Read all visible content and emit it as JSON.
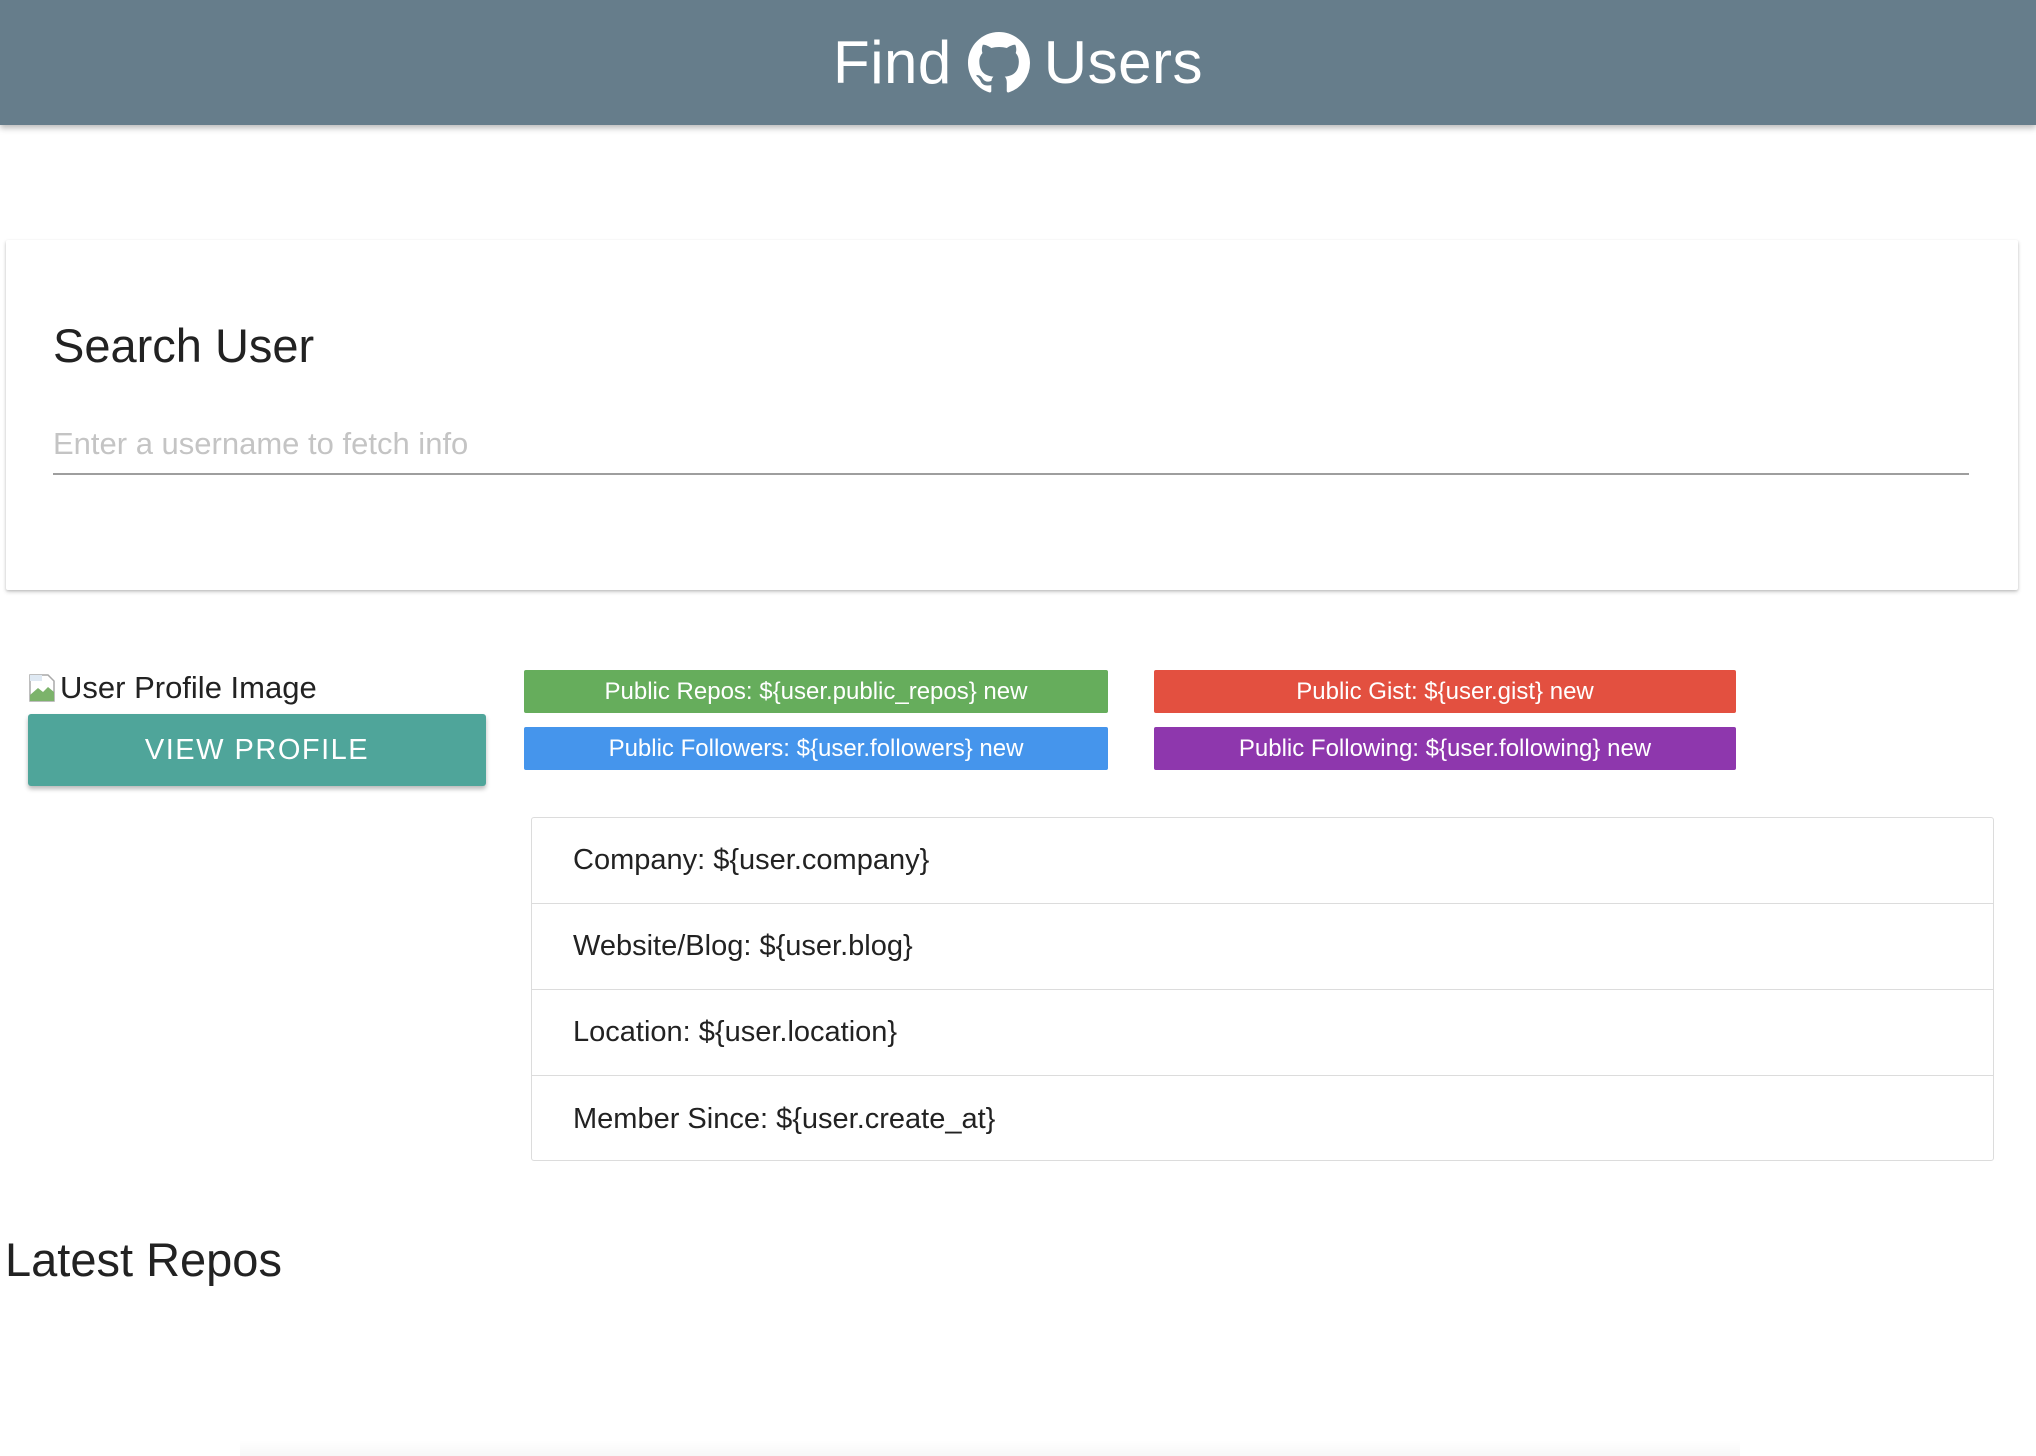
{
  "header": {
    "title_before": "Find",
    "title_after": "Users",
    "icon": "github-icon",
    "background": "#667d8b"
  },
  "search": {
    "title": "Search User",
    "placeholder": "Enter a username to fetch info",
    "value": ""
  },
  "profile": {
    "image_alt": "User Profile Image",
    "view_button_label": "View Profile",
    "button_color": "#4fa59a"
  },
  "badges": {
    "public_repos": {
      "label": "Public Repos: ${user.public_repos} new",
      "color": "#66ad5c"
    },
    "public_gists": {
      "label": "Public Gist: ${user.gist} new",
      "color": "#e35040"
    },
    "public_followers": {
      "label": "Public Followers: ${user.followers} new",
      "color": "#4595ec"
    },
    "public_following": {
      "label": "Public Following: ${user.following} new",
      "color": "#8e37ad"
    }
  },
  "info": {
    "items": [
      {
        "label": "Company: ${user.company}"
      },
      {
        "label": "Website/Blog: ${user.blog}"
      },
      {
        "label": "Location: ${user.location}"
      },
      {
        "label": "Member Since: ${user.create_at}"
      }
    ]
  },
  "repos": {
    "heading": "Latest Repos"
  }
}
